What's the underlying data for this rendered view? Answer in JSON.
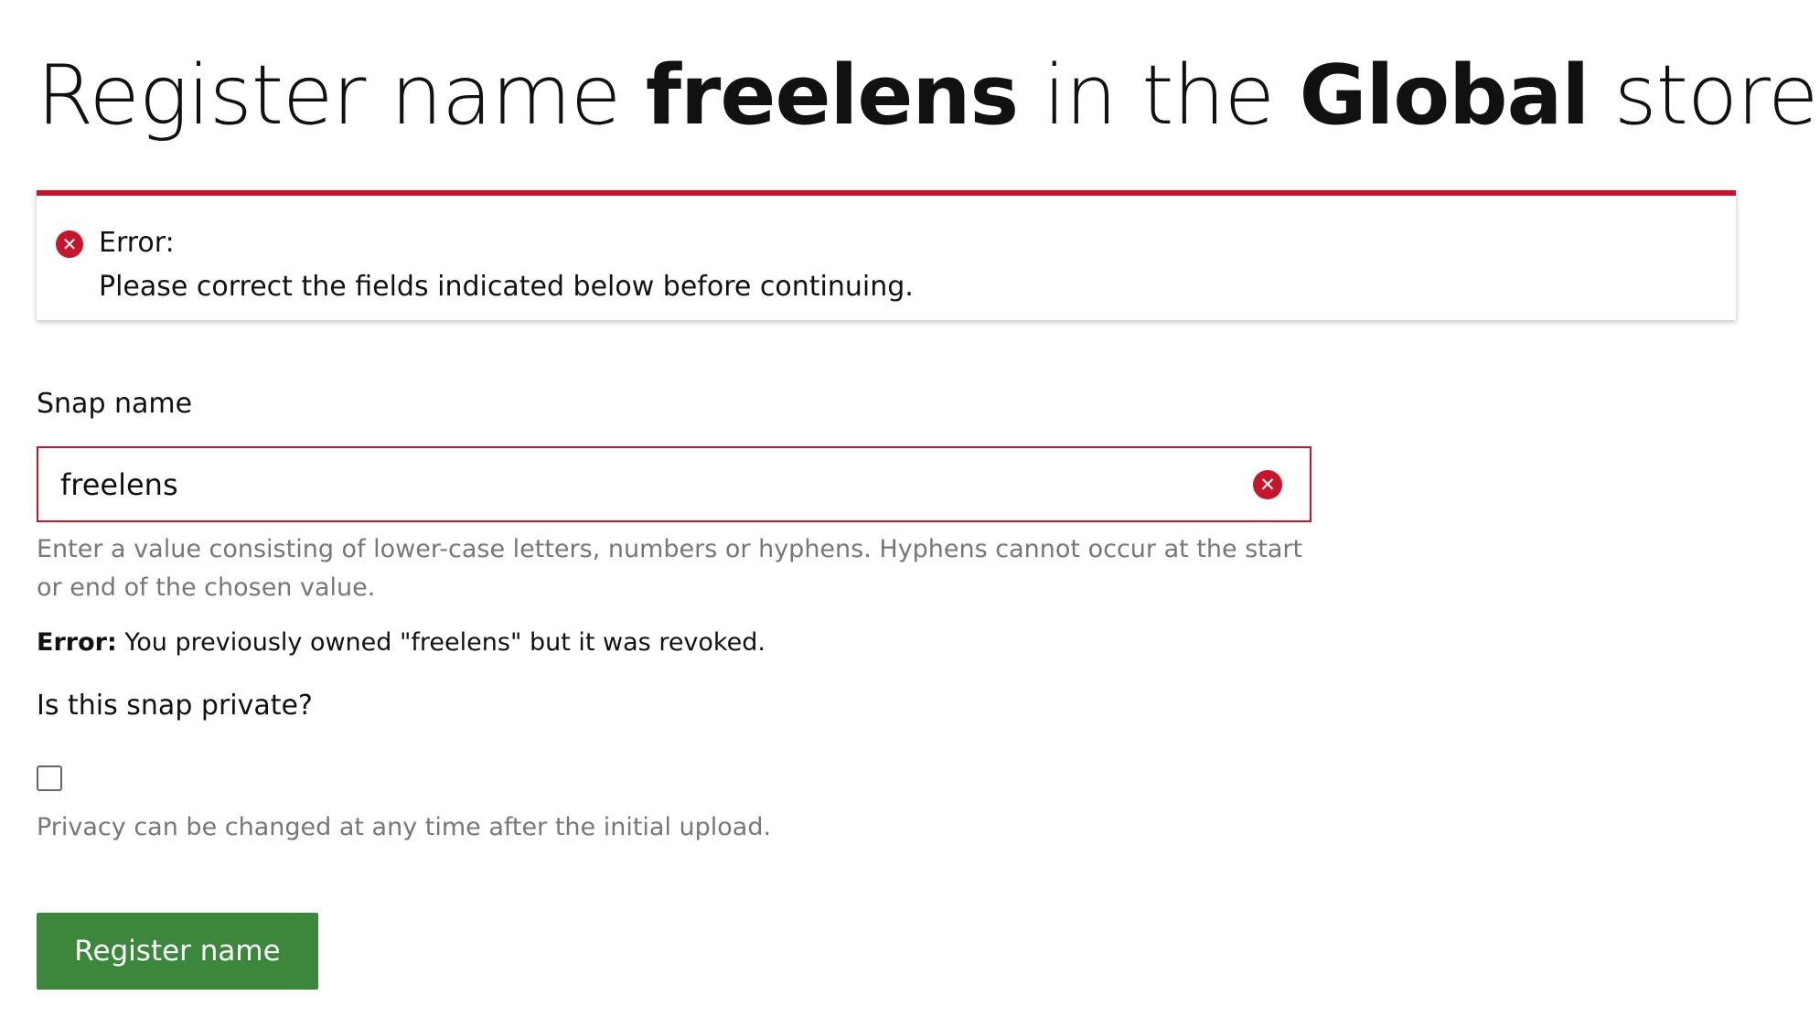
{
  "header": {
    "prefix": "Register name ",
    "snap_name": "freelens",
    "middle": " in the ",
    "store_name": "Global",
    "suffix": " store"
  },
  "notification": {
    "status": "error",
    "icon": "error-circle-icon",
    "title": "Error:",
    "message": "Please correct the fields indicated below before continuing.",
    "accent_color": "#c7162b"
  },
  "form": {
    "snap_name_field": {
      "label": "Snap name",
      "value": "freelens",
      "error_icon": "error-circle-icon",
      "help": "Enter a value consisting of lower-case letters, numbers or hyphens. Hyphens cannot occur at the start or end of the chosen value.",
      "error_prefix": "Error:",
      "error_message": " You previously owned \"freelens\" but it was revoked."
    },
    "private_field": {
      "label": "Is this snap private?",
      "checked": false,
      "help": "Privacy can be changed at any time after the initial upload."
    },
    "submit": {
      "label": "Register name",
      "color": "#3b873b"
    }
  }
}
